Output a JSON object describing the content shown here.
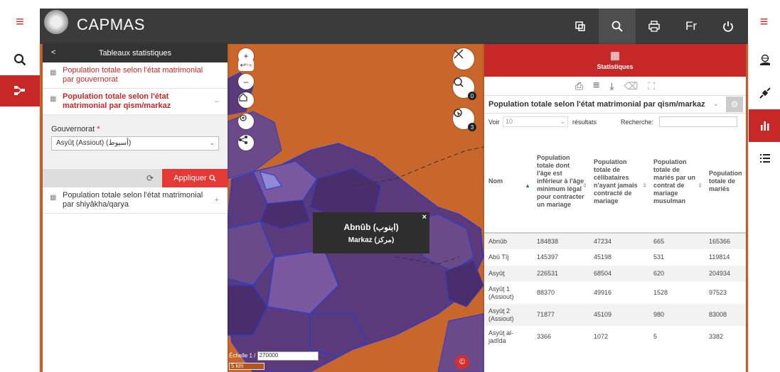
{
  "header": {
    "app_title": "CAPMAS",
    "lang": "Fr"
  },
  "left_panel": {
    "title": "Tableaux statistiques",
    "items": [
      {
        "label": "Population totale selon l'état matrimonial par gouvernorat"
      },
      {
        "label": "Population totale selon l'état matrimonial par qism/markaz"
      },
      {
        "label": "Population totale selon l'état matrimonial par shiyâkha/qarya"
      }
    ],
    "form": {
      "field_label": "Gouvernorat",
      "required_mark": "*",
      "selected_value": "Asyûţ (Assiout) (أسيوط)",
      "apply_label": "Appliquer"
    }
  },
  "map": {
    "selected_count": "0",
    "selection_count": "3",
    "popup": {
      "name": "Abnûb (ابنوب)",
      "type": "Markaz (مركز)",
      "close": "×"
    },
    "scale_label": "Échelle 1 /",
    "scale_value": "270000",
    "scale_bar": "5 km",
    "copyright": "©"
  },
  "stats_panel": {
    "title": "Statistiques",
    "table_name": "Population totale selon l'état matrimonial par qism/markaz",
    "voir_label": "Voir",
    "page_size": "10",
    "results_label": "résultats",
    "search_label": "Recherche:",
    "columns": [
      "Nom",
      "Population totale dont l'âge est inférieur à l'âge minimum légal pour contracter un mariage",
      "Population totale de célibataires n'ayant jamais contracté de mariage",
      "Population totale de mariés par un contrat de mariage musulman",
      "Population totale de mariés"
    ],
    "rows": [
      {
        "name": "Abnûb",
        "c1": "184838",
        "c2": "47234",
        "c3": "665",
        "c4": "165366"
      },
      {
        "name": "Abû Tîj",
        "c1": "145397",
        "c2": "45198",
        "c3": "531",
        "c4": "119814"
      },
      {
        "name": "Asyûţ",
        "c1": "226531",
        "c2": "68504",
        "c3": "620",
        "c4": "204934"
      },
      {
        "name": "Asyûţ 1 (Assiout)",
        "c1": "88370",
        "c2": "49916",
        "c3": "1528",
        "c4": "97523"
      },
      {
        "name": "Asyûţ 2 (Assiout)",
        "c1": "71877",
        "c2": "45109",
        "c3": "980",
        "c4": "83008"
      },
      {
        "name": "Asyûţ al-jadîda",
        "c1": "3366",
        "c2": "1072",
        "c3": "5",
        "c4": "3382"
      }
    ]
  }
}
